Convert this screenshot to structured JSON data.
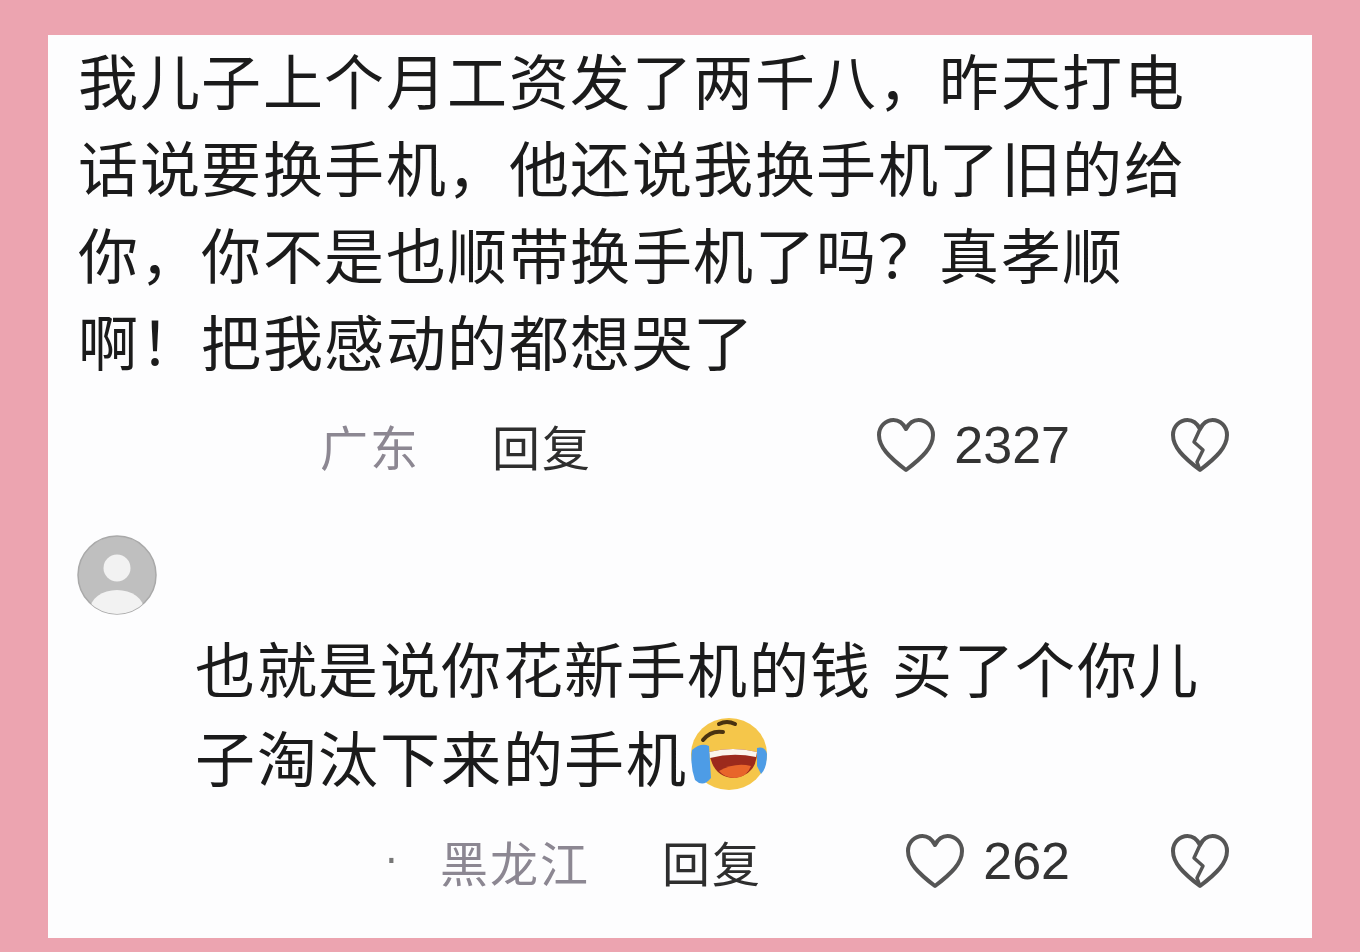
{
  "comments": [
    {
      "has_avatar": false,
      "text": "我儿子上个月工资发了两千八，昨天打电话说要换手机，他还说我换手机了旧的给你，你不是也顺带换手机了吗？真孝顺啊！把我感动的都想哭了",
      "has_emoji": false,
      "location": "广东",
      "reply": "回复",
      "likes": "2327"
    },
    {
      "has_avatar": true,
      "text": "也就是说你花新手机的钱 买了个你儿子淘汰下来的手机",
      "has_emoji": true,
      "separator": "·",
      "location": "黑龙江",
      "reply": "回复",
      "likes": "262"
    }
  ]
}
